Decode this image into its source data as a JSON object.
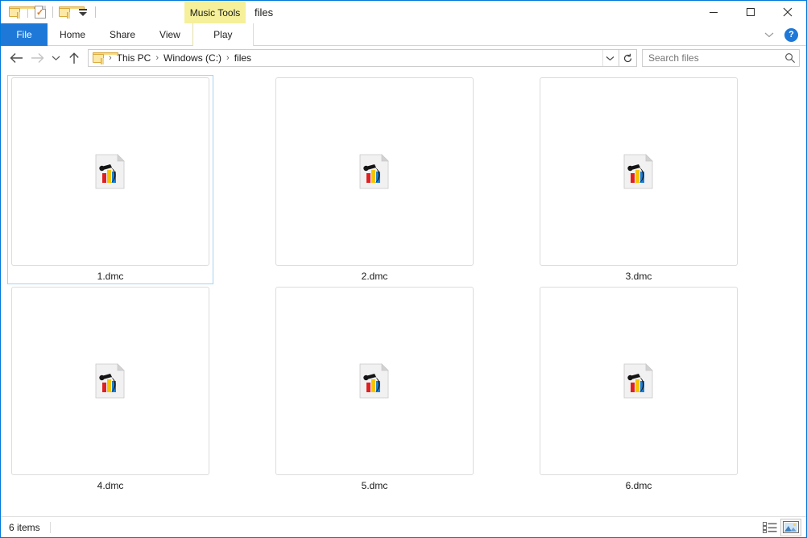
{
  "window": {
    "title": "files",
    "contextual_tab": "Music Tools",
    "border_color": "#0078d7"
  },
  "quick_access": {
    "items": [
      {
        "name": "folder-icon",
        "label": "Folder"
      },
      {
        "name": "properties-icon",
        "label": "Properties"
      },
      {
        "name": "new-folder-icon",
        "label": "New folder"
      },
      {
        "name": "customize-quick-access-icon",
        "label": "Customize Quick Access Toolbar"
      }
    ]
  },
  "window_controls": {
    "minimize": "Minimize",
    "maximize": "Maximize",
    "close": "Close",
    "collapse_ribbon": "Minimize the Ribbon",
    "help": "?"
  },
  "ribbon": {
    "tabs": [
      {
        "label": "File",
        "active": true,
        "style": "file"
      },
      {
        "label": "Home",
        "active": false,
        "style": "normal"
      },
      {
        "label": "Share",
        "active": false,
        "style": "normal"
      },
      {
        "label": "View",
        "active": false,
        "style": "normal"
      },
      {
        "label": "Play",
        "active": false,
        "style": "contextual"
      }
    ],
    "accent_color": "#1e78d7",
    "contextual_color": "#f5f099"
  },
  "address_bar": {
    "back": "Back",
    "forward": "Forward",
    "recent": "Recent locations",
    "up": "Up one level",
    "breadcrumb": [
      "This PC",
      "Windows (C:)",
      "files"
    ],
    "separator": "›",
    "dropdown": "Previous locations",
    "refresh": "Refresh"
  },
  "search": {
    "placeholder": "Search files",
    "value": "",
    "icon": "search-icon"
  },
  "files": [
    {
      "name": "1.dmc",
      "selected": true
    },
    {
      "name": "2.dmc",
      "selected": false
    },
    {
      "name": "3.dmc",
      "selected": false
    },
    {
      "name": "4.dmc",
      "selected": false
    },
    {
      "name": "5.dmc",
      "selected": false
    },
    {
      "name": "6.dmc",
      "selected": false
    }
  ],
  "file_icon": {
    "name": "dmc-file-icon",
    "page_color": "#f2f2f2",
    "bar_colors": [
      "#e02020",
      "#f5c400",
      "#1a7fd4"
    ],
    "mark_color": "#1a1a1a"
  },
  "status_bar": {
    "item_count": "6 items",
    "views": [
      {
        "name": "details-view-button",
        "label": "Details view",
        "active": false
      },
      {
        "name": "large-icons-view-button",
        "label": "Large icons view",
        "active": true
      }
    ]
  },
  "selection": {
    "border_color": "#a3d4f0",
    "thumb_border_color": "#dcdcdc"
  }
}
